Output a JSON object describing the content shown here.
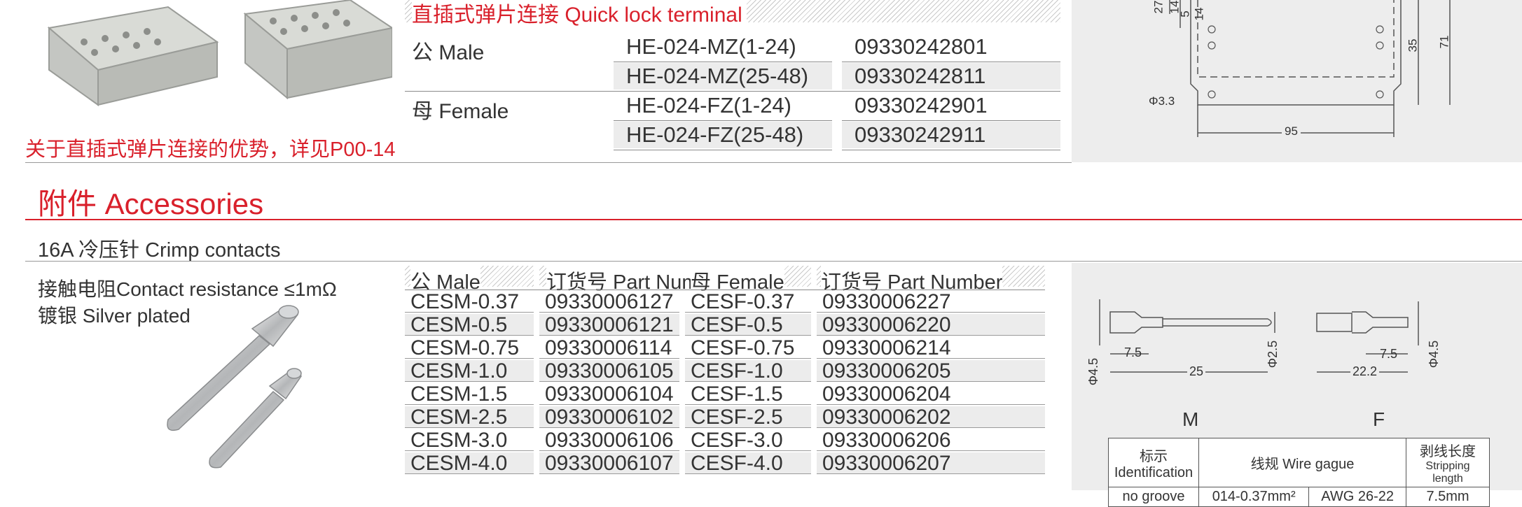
{
  "top": {
    "title": "直插式弹片连接 Quick lock terminal",
    "note": "关于直插式弹片连接的优势，详见P00-14",
    "rows": [
      {
        "gender": "公 Male",
        "model": "HE-024-MZ(1-24)",
        "part": "09330242801"
      },
      {
        "gender": "",
        "model": "HE-024-MZ(25-48)",
        "part": "09330242811"
      },
      {
        "gender": "母 Female",
        "model": "HE-024-FZ(1-24)",
        "part": "09330242901"
      },
      {
        "gender": "",
        "model": "HE-024-FZ(25-48)",
        "part": "09330242911"
      }
    ],
    "drawing": {
      "d1": "27",
      "d2": "14",
      "d3": "5",
      "d4": "14",
      "d5": "35",
      "d6": "71",
      "hole": "Φ3.3",
      "width": "95"
    }
  },
  "accessories": {
    "title": "附件 Accessories",
    "crimp_title": "16A 冷压针 Crimp contacts",
    "contact_resistance": "接触电阻Contact resistance ≤1mΩ",
    "plating": "镀银 Silver plated",
    "headers": {
      "male": "公 Male",
      "male_part": "订货号 Part Number",
      "female": "母 Female",
      "female_part": "订货号 Part Number"
    },
    "rows": [
      {
        "male": "CESM-0.37",
        "male_part": "09330006127",
        "female": "CESF-0.37",
        "female_part": "09330006227"
      },
      {
        "male": "CESM-0.5",
        "male_part": "09330006121",
        "female": "CESF-0.5",
        "female_part": "09330006220"
      },
      {
        "male": "CESM-0.75",
        "male_part": "09330006114",
        "female": "CESF-0.75",
        "female_part": "09330006214"
      },
      {
        "male": "CESM-1.0",
        "male_part": "09330006105",
        "female": "CESF-1.0",
        "female_part": "09330006205"
      },
      {
        "male": "CESM-1.5",
        "male_part": "09330006104",
        "female": "CESF-1.5",
        "female_part": "09330006204"
      },
      {
        "male": "CESM-2.5",
        "male_part": "09330006102",
        "female": "CESF-2.5",
        "female_part": "09330006202"
      },
      {
        "male": "CESM-3.0",
        "male_part": "09330006106",
        "female": "CESF-3.0",
        "female_part": "09330006206"
      },
      {
        "male": "CESM-4.0",
        "male_part": "09330006107",
        "female": "CESF-4.0",
        "female_part": "09330006207"
      }
    ],
    "drawing": {
      "m_label": "M",
      "f_label": "F",
      "m_dia": "Φ4.5",
      "m_strip": "7.5",
      "m_len": "25",
      "m_pin": "Φ2.5",
      "f_strip": "7.5",
      "f_len": "22.2",
      "f_dia": "Φ4.5",
      "spec": {
        "h_ident_cn": "标示",
        "h_ident_en": "Identification",
        "h_wire": "线规 Wire gague",
        "h_strip_cn": "剥线长度",
        "h_strip_en": "Stripping length",
        "r1_ident": "no groove",
        "r1_mm": "014-0.37mm²",
        "r1_awg": "AWG 26-22",
        "r1_strip": "7.5mm"
      }
    }
  }
}
